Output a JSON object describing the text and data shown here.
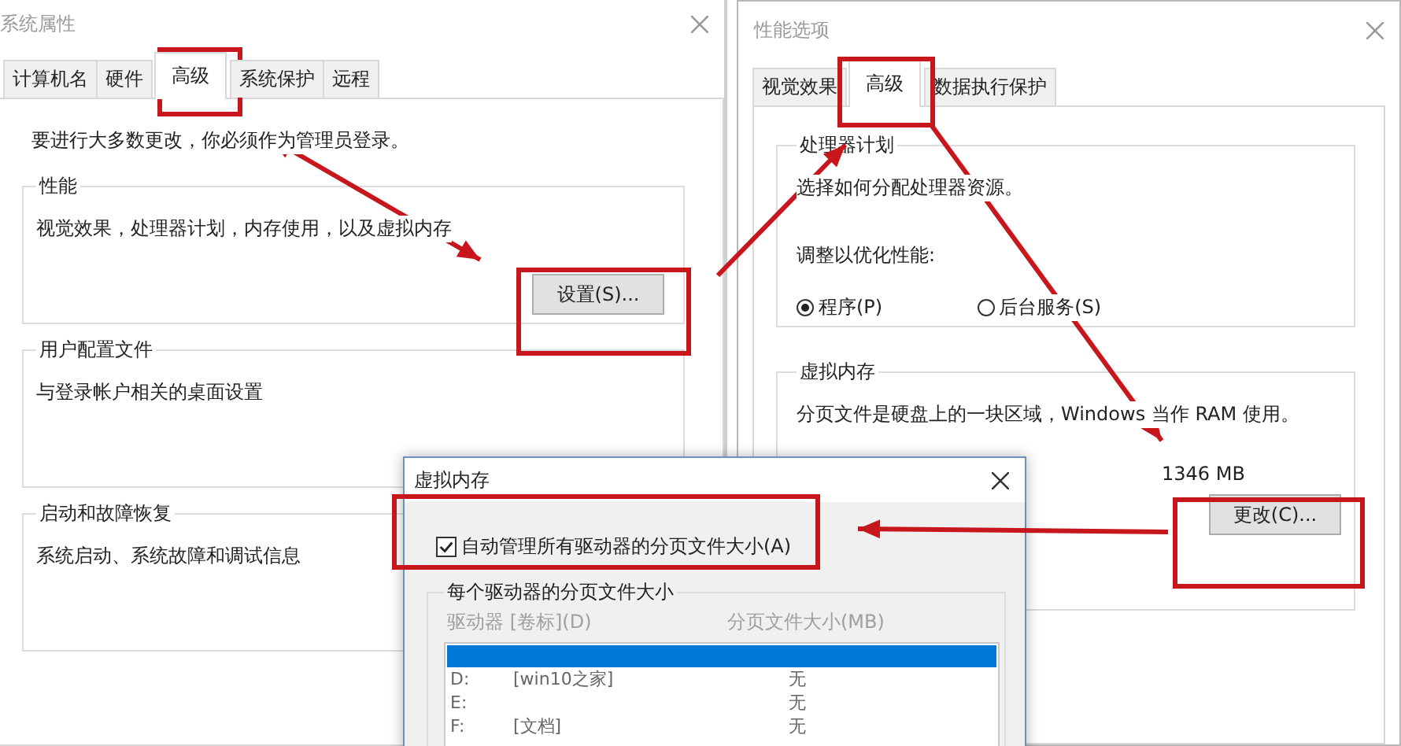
{
  "system_properties": {
    "title": "系统属性",
    "tabs": [
      {
        "label": "计算机名",
        "selected": false
      },
      {
        "label": "硬件",
        "selected": false
      },
      {
        "label": "高级",
        "selected": true
      },
      {
        "label": "系统保护",
        "selected": false
      },
      {
        "label": "远程",
        "selected": false
      }
    ],
    "notice": "要进行大多数更改，你必须作为管理员登录。",
    "groups": [
      {
        "title": "性能",
        "text": "视觉效果，处理器计划，内存使用，以及虚拟内存",
        "button": "设置(S)..."
      },
      {
        "title": "用户配置文件",
        "text": "与登录帐户相关的桌面设置"
      },
      {
        "title": "启动和故障恢复",
        "text": "系统启动、系统故障和调试信息"
      }
    ]
  },
  "performance_options": {
    "title": "性能选项",
    "tabs": [
      {
        "label": "视觉效果",
        "selected": false
      },
      {
        "label": "高级",
        "selected": true
      },
      {
        "label": "数据执行保护",
        "selected": false
      }
    ],
    "processor_scheduling": {
      "title": "处理器计划",
      "text": "选择如何分配处理器资源。",
      "prompt": "调整以优化性能:",
      "options": [
        {
          "label": "程序(P)",
          "selected": true
        },
        {
          "label": "后台服务(S)",
          "selected": false
        }
      ]
    },
    "virtual_memory": {
      "title": "虚拟内存",
      "text": "分页文件是硬盘上的一块区域，Windows 当作 RAM 使用。",
      "total": "1346 MB",
      "button": "更改(C)..."
    }
  },
  "virtual_memory_dialog": {
    "title": "虚拟内存",
    "auto_manage": {
      "label": "自动管理所有驱动器的分页文件大小(A)",
      "checked": true
    },
    "drives": {
      "title": "每个驱动器的分页文件大小",
      "disabled": true,
      "columns": [
        "驱动器 [卷标](D)",
        "分页文件大小(MB)"
      ],
      "rows": [
        {
          "selected": true
        },
        {
          "drive": "D:",
          "label": "[win10之家]",
          "size": "无",
          "selected": false
        },
        {
          "drive": "E:",
          "size": "无",
          "selected": false
        },
        {
          "drive": "F:",
          "label": "[文档]",
          "size": "无",
          "selected": false
        }
      ]
    }
  }
}
